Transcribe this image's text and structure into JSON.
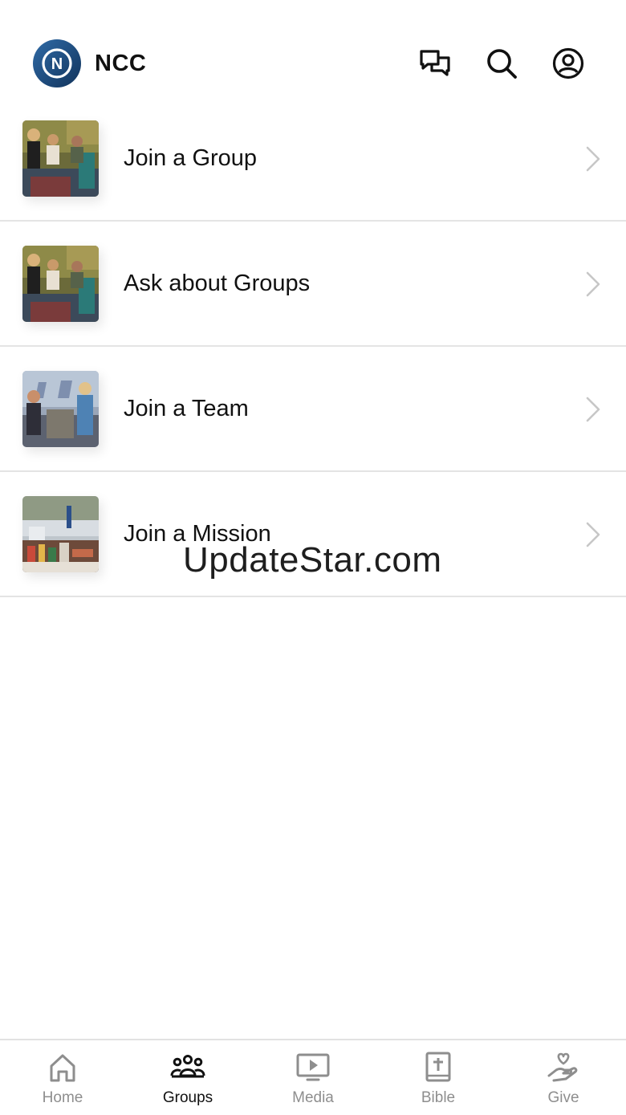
{
  "header": {
    "title": "NCC",
    "logo_letter": "N",
    "icons": [
      "chat-icon",
      "search-icon",
      "account-icon"
    ]
  },
  "list": {
    "items": [
      {
        "label": "Join a Group",
        "thumb": "group-photo"
      },
      {
        "label": "Ask about Groups",
        "thumb": "group-photo"
      },
      {
        "label": "Join a Team",
        "thumb": "kids-team-photo"
      },
      {
        "label": "Join a Mission",
        "thumb": "mission-photo"
      }
    ]
  },
  "watermark": "UpdateStar.com",
  "tabbar": {
    "active": "Groups",
    "tabs": [
      {
        "label": "Home",
        "icon": "home-icon"
      },
      {
        "label": "Groups",
        "icon": "groups-icon"
      },
      {
        "label": "Media",
        "icon": "media-icon"
      },
      {
        "label": "Bible",
        "icon": "bible-icon"
      },
      {
        "label": "Give",
        "icon": "give-icon"
      }
    ]
  },
  "colors": {
    "active_tab": "#111111",
    "inactive_tab": "#8e8e8e",
    "logo_blue": "#1f4b7e",
    "divider": "#e4e4e4"
  }
}
